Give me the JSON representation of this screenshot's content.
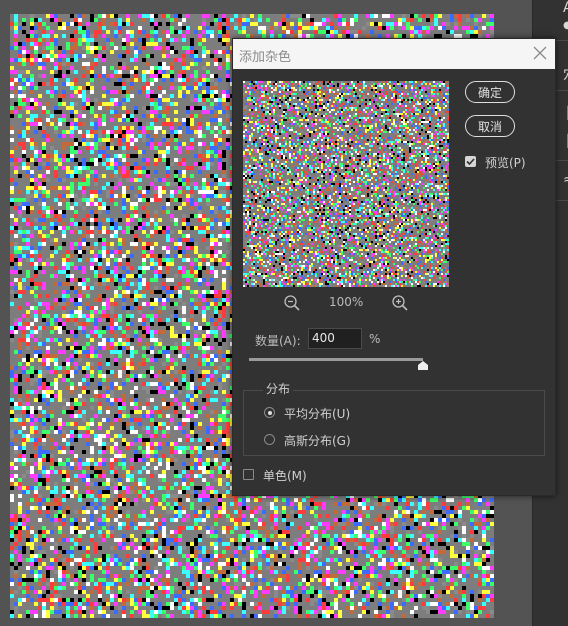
{
  "dialog": {
    "title": "添加杂色",
    "ok_label": "确定",
    "cancel_label": "取消",
    "preview_label": "预览(P)",
    "preview_checked": true,
    "zoom_level": "100%",
    "amount_label": "数量(A):",
    "amount_value": "400",
    "amount_unit": "%",
    "amount_percent": 400,
    "distribution": {
      "legend": "分布",
      "uniform_label": "平均分布(U)",
      "gaussian_label": "高斯分布(G)",
      "selected": "uniform"
    },
    "monochromatic_label": "单色(M)",
    "monochromatic_checked": false
  },
  "icons": {
    "close": "close-icon",
    "zoom_out": "zoom-out-icon",
    "zoom_in": "zoom-in-icon",
    "checkbox": "checkmark-icon"
  },
  "colors": {
    "dialog_bg": "#323232",
    "titlebar_bg": "#f5f5f5",
    "workspace_bg": "#535353"
  }
}
